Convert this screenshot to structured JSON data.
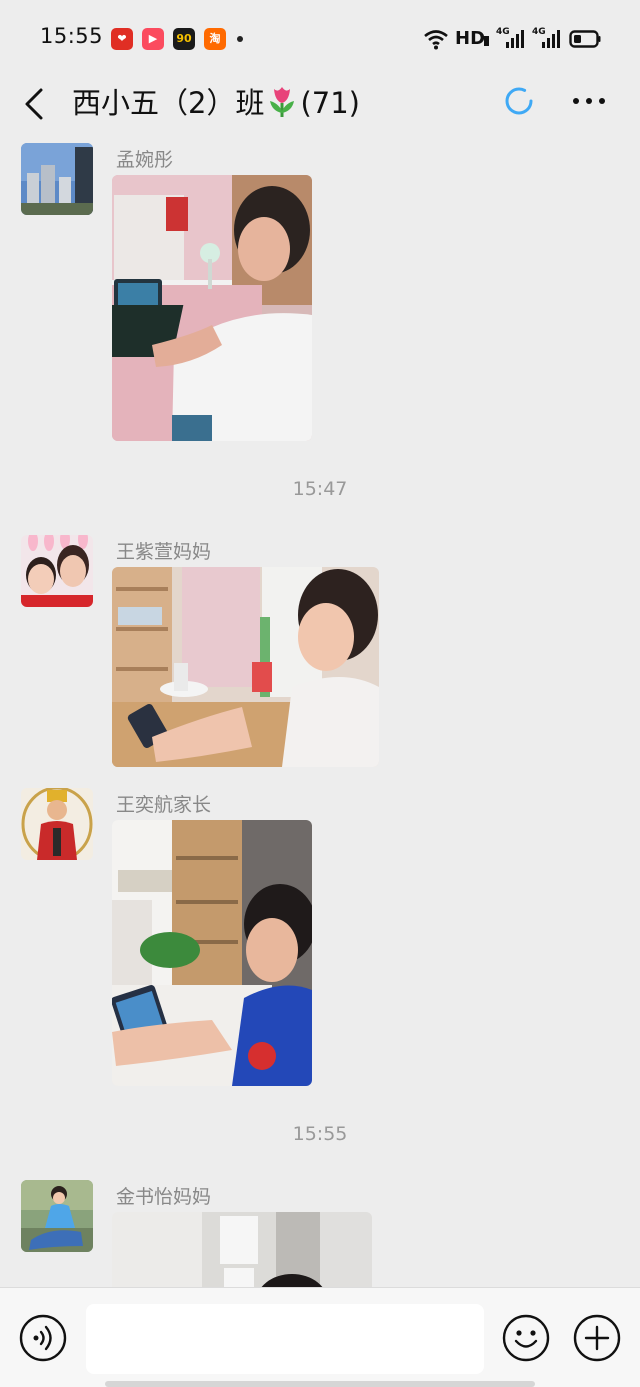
{
  "status_bar": {
    "time": "15:55",
    "network_type": "HD",
    "signal_1_label": "4G",
    "signal_2_label": "4G",
    "app_icons": [
      {
        "name": "pinduoduo-icon",
        "color": "#e02e24",
        "glyph": "❤"
      },
      {
        "name": "video-app-icon",
        "color": "#fb4b5e",
        "glyph": "▶"
      },
      {
        "name": "shopping-app-icon",
        "color": "#1a1a1a",
        "glyph": "90"
      },
      {
        "name": "taobao-icon",
        "color": "#ff6a00",
        "glyph": "淘"
      }
    ]
  },
  "header": {
    "title_main": "西小五（2）班",
    "title_count": "(71)",
    "loading_color": "#3fa9f5"
  },
  "messages": [
    {
      "sender": "孟婉彤",
      "type": "image"
    },
    {
      "timestamp": "15:47"
    },
    {
      "sender": "王紫萱妈妈",
      "type": "image"
    },
    {
      "sender": "王奕航家长",
      "type": "image"
    },
    {
      "timestamp": "15:55"
    },
    {
      "sender": "金书怡妈妈",
      "type": "image"
    }
  ],
  "input_bar": {
    "placeholder": "",
    "value": ""
  }
}
